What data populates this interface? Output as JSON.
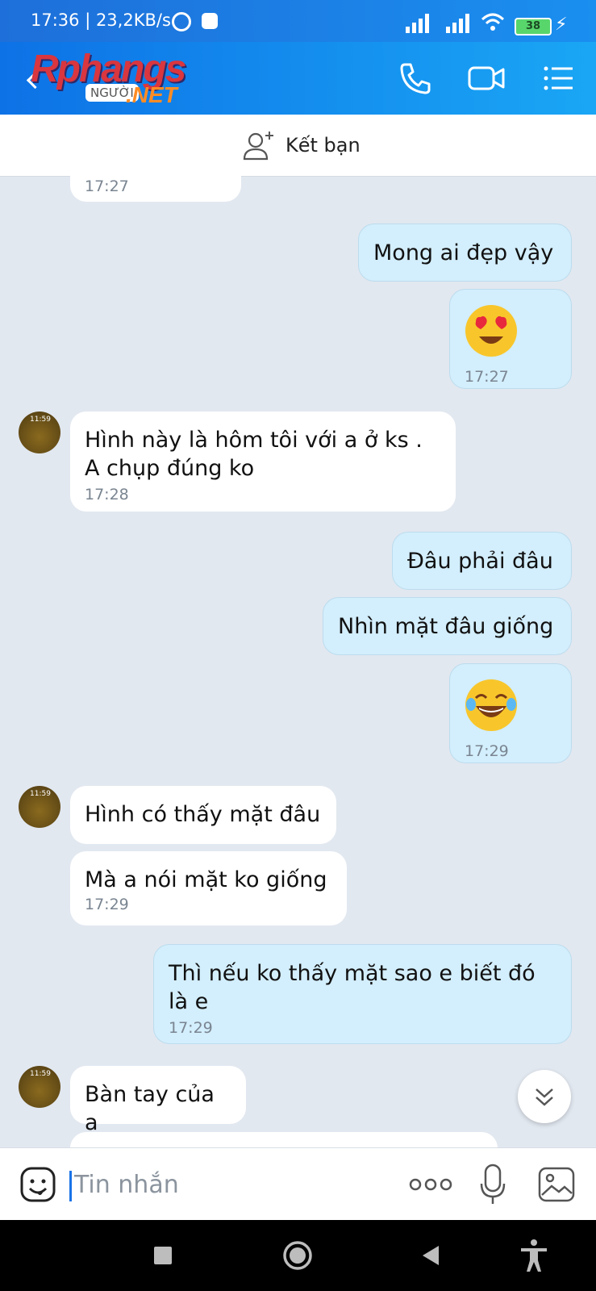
{
  "status_bar": {
    "time_speed": "17:36 | 23,2KB/s",
    "battery": "38"
  },
  "header": {
    "logo_text": "Rphangs",
    "logo_badge": "NGƯỜI",
    "logo_suffix": ".NET"
  },
  "friend_bar": {
    "label": "Kết bạn"
  },
  "messages": [
    {
      "dir": "in",
      "time": "17:27"
    },
    {
      "dir": "out",
      "text": "Mong ai đẹp vậy"
    },
    {
      "dir": "out",
      "emoji": "heart-eyes",
      "time": "17:27"
    },
    {
      "dir": "in",
      "text": "Hình này là hôm tôi với a ở ks . A chụp đúng ko",
      "time": "17:28"
    },
    {
      "dir": "out",
      "text": "Đâu phải đâu"
    },
    {
      "dir": "out",
      "text": "Nhìn mặt đâu giống"
    },
    {
      "dir": "out",
      "emoji": "tears-of-joy",
      "time": "17:29"
    },
    {
      "dir": "in",
      "text": "Hình có thấy mặt đâu"
    },
    {
      "dir": "in",
      "text": "Mà a nói mặt ko giống",
      "time": "17:29"
    },
    {
      "dir": "out",
      "text": "Thì nếu ko thấy mặt sao e biết đó là e",
      "time": "17:29"
    },
    {
      "dir": "in",
      "text": "Bàn tay của a"
    }
  ],
  "avatar_clock": "11:59",
  "input": {
    "placeholder": "Tin nhắn"
  },
  "colors": {
    "header": "#1a8ff0",
    "outgoing_bubble": "#d3eefc",
    "incoming_bubble": "#ffffff",
    "background": "#e2e8f0"
  }
}
